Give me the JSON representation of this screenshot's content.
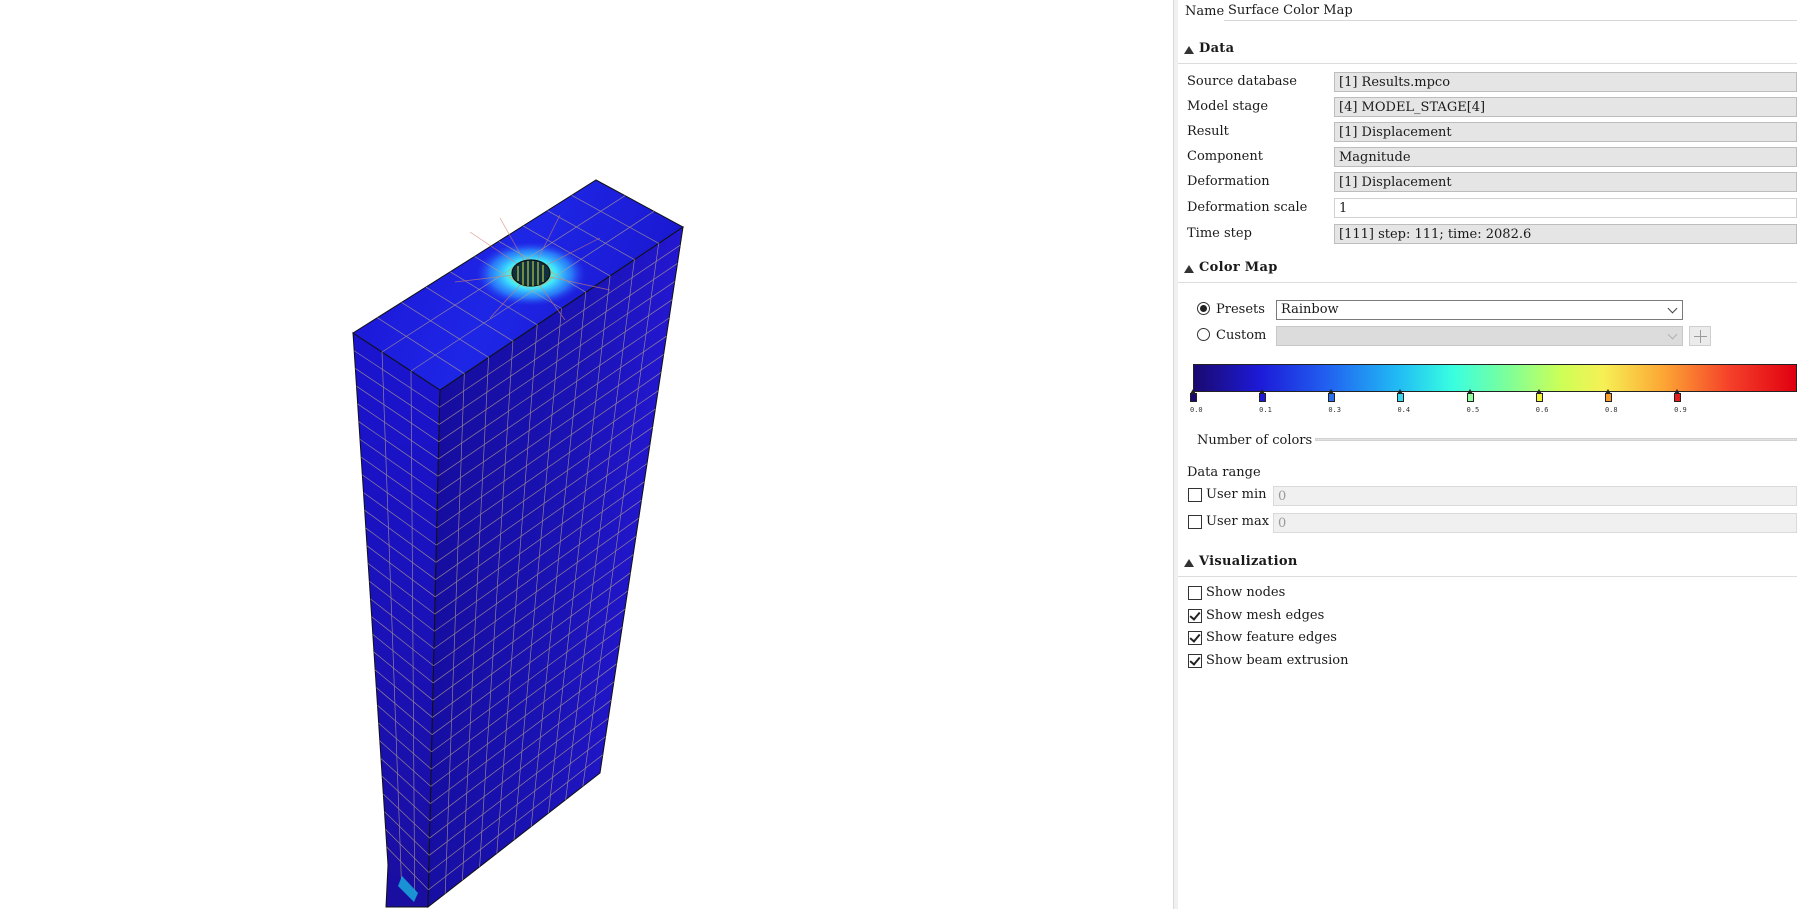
{
  "properties": {
    "name_label": "Name",
    "name_value": "Surface Color Map"
  },
  "data_section": {
    "title": "Data",
    "rows": [
      {
        "label": "Source database",
        "value": "[1] Results.mpco"
      },
      {
        "label": "Model stage",
        "value": "[4] MODEL_STAGE[4]"
      },
      {
        "label": "Result",
        "value": "[1] Displacement"
      },
      {
        "label": "Component",
        "value": "Magnitude"
      },
      {
        "label": "Deformation",
        "value": "[1] Displacement"
      },
      {
        "label": "Deformation scale",
        "value": "1"
      },
      {
        "label": "Time step",
        "value": "[111] step: 111; time: 2082.6"
      }
    ]
  },
  "colormap_section": {
    "title": "Color Map",
    "presets_label": "Presets",
    "presets_value": "Rainbow",
    "presets_selected": true,
    "custom_label": "Custom",
    "custom_value": "",
    "custom_selected": false,
    "stops": [
      {
        "label": "0.0",
        "color": "#1a0a70",
        "pos": 0.0
      },
      {
        "label": "0.1",
        "color": "#1d1ad8",
        "pos": 0.1145
      },
      {
        "label": "0.3",
        "color": "#2a6ff0",
        "pos": 0.229
      },
      {
        "label": "0.4",
        "color": "#3ad6f0",
        "pos": 0.3435
      },
      {
        "label": "0.5",
        "color": "#8fffa0",
        "pos": 0.458
      },
      {
        "label": "0.6",
        "color": "#f2f23a",
        "pos": 0.5725
      },
      {
        "label": "0.8",
        "color": "#f79b2a",
        "pos": 0.687
      },
      {
        "label": "0.9",
        "color": "#e81b1b",
        "pos": 0.8015
      }
    ],
    "number_of_colors_label": "Number of colors",
    "data_range_label": "Data range",
    "user_min_label": "User min",
    "user_min_value": "0",
    "user_min_checked": false,
    "user_max_label": "User max",
    "user_max_value": "0",
    "user_max_checked": false
  },
  "visualization_section": {
    "title": "Visualization",
    "options": [
      {
        "label": "Show nodes",
        "checked": false
      },
      {
        "label": "Show mesh edges",
        "checked": true
      },
      {
        "label": "Show feature edges",
        "checked": true
      },
      {
        "label": "Show beam extrusion",
        "checked": true
      }
    ]
  },
  "viewport": {
    "model": "mesh-block",
    "surface_color": "#1a14c8",
    "mesh_edge_color": "#b8a48a",
    "hotspot_color": "#ffd21a"
  }
}
